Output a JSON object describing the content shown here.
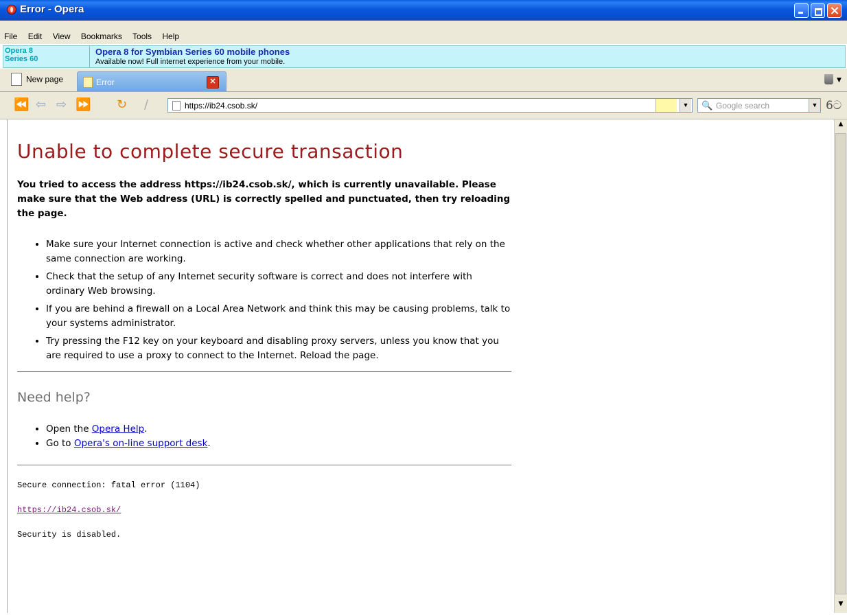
{
  "window": {
    "title": "Error - Opera"
  },
  "menu": [
    "File",
    "Edit",
    "View",
    "Bookmarks",
    "Tools",
    "Help"
  ],
  "ad": {
    "logo_line1": "Opera 8",
    "logo_line2": "Series 60",
    "headline": "Opera 8 for Symbian Series 60 mobile phones",
    "subline": "Available now! Full internet experience from your mobile."
  },
  "tabs": {
    "new_page": "New page",
    "active": "Error"
  },
  "address": {
    "url": "https://ib24.csob.sk/"
  },
  "search": {
    "placeholder": "Google search"
  },
  "page": {
    "heading": "Unable to complete secure transaction",
    "lead": "You tried to access the address https://ib24.csob.sk/, which is currently unavailable. Please make sure that the Web address (URL) is correctly spelled and punctuated, then try reloading the page.",
    "tips": [
      "Make sure your Internet connection is active and check whether other applications that rely on the same connection are working.",
      "Check that the setup of any Internet security software is correct and does not interfere with ordinary Web browsing.",
      "If you are behind a firewall on a Local Area Network and think this may be causing problems, talk to your systems administrator.",
      "Try pressing the F12 key on your keyboard and disabling proxy servers, unless you know that you are required to use a proxy to connect to the Internet. Reload the page."
    ],
    "help_heading": "Need help?",
    "help": [
      {
        "prefix": "Open the ",
        "link": "Opera Help",
        "suffix": "."
      },
      {
        "prefix": "Go to ",
        "link": "Opera's on-line support desk",
        "suffix": "."
      }
    ],
    "error_text": "Secure connection: fatal error (1104)",
    "error_link": "https://ib24.csob.sk/",
    "security_text": "Security is disabled."
  }
}
